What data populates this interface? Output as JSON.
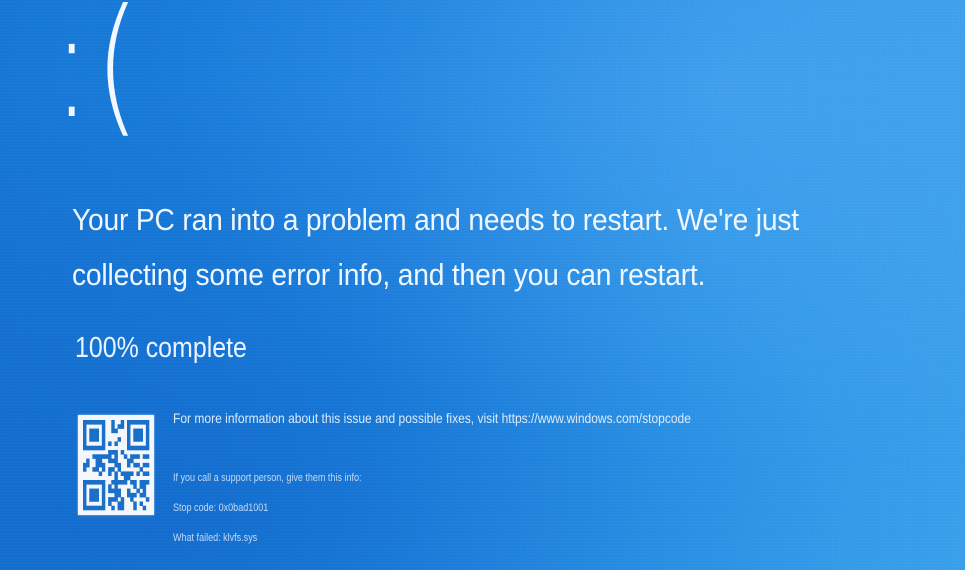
{
  "sad_face": ":(",
  "headline": "Your PC ran into a problem and needs to restart. We're just collecting some error info, and then you can restart.",
  "progress": {
    "text": "100% complete",
    "percent": 100
  },
  "qr_code": {
    "icon": "qr-code-icon"
  },
  "details": {
    "more_info": "For more information about this issue and possible fixes, visit https://www.windows.com/stopcode",
    "support_prompt": "If you call a support person, give them this info:",
    "stop_code": "Stop code: 0x0bad1001",
    "what_failed": "What failed: klvfs.sys"
  },
  "colors": {
    "background": "#1a7fdc",
    "text": "#eef6ff"
  }
}
